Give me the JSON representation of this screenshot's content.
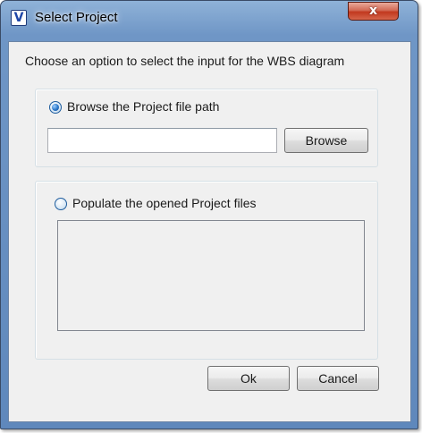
{
  "window": {
    "title": "Select Project",
    "app_icon_glyph": "V",
    "close_glyph": "x"
  },
  "dialog": {
    "prompt": "Choose an option to select the input for the WBS diagram",
    "browse_option": {
      "label": "Browse the Project file path",
      "selected": true,
      "path_value": "",
      "browse_button_label": "Browse"
    },
    "populate_option": {
      "label": "Populate the opened Project files",
      "selected": false,
      "files": []
    },
    "ok_label": "Ok",
    "cancel_label": "Cancel"
  },
  "colors": {
    "title_bar": "#6f96c6",
    "close_button": "#c2381f",
    "dialog_background": "#f0f0f0",
    "radio_checked": "#2a76c8"
  },
  "icons": {
    "app": "app-v-icon",
    "close": "close-icon"
  }
}
